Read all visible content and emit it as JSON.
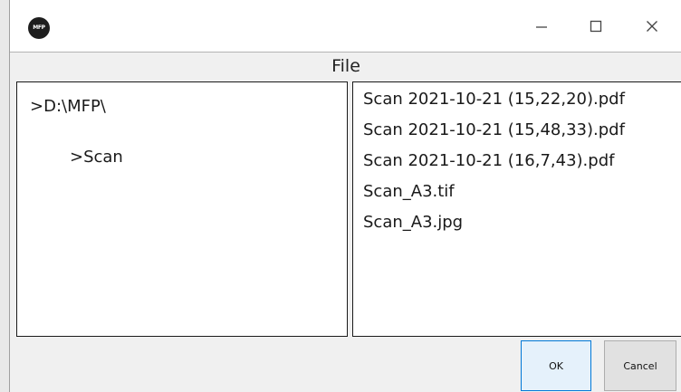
{
  "window": {
    "app_icon_text": "MFP",
    "controls": {
      "minimize": "minimize",
      "maximize": "maximize",
      "close": "close"
    }
  },
  "header": {
    "label": "File"
  },
  "folder_tree": [
    ">D:\\MFP\\",
    ">Scan"
  ],
  "files": [
    "Scan 2021-10-21 (15,22,20).pdf",
    "Scan 2021-10-21 (15,48,33).pdf",
    "Scan 2021-10-21 (16,7,43).pdf",
    "Scan_A3.tif",
    "Scan_A3.jpg"
  ],
  "buttons": {
    "ok": "OK",
    "cancel": "Cancel"
  },
  "colors": {
    "ok_border": "#0078d7",
    "ok_background": "#e5f1fb",
    "dialog_background": "#f0f0f0"
  }
}
